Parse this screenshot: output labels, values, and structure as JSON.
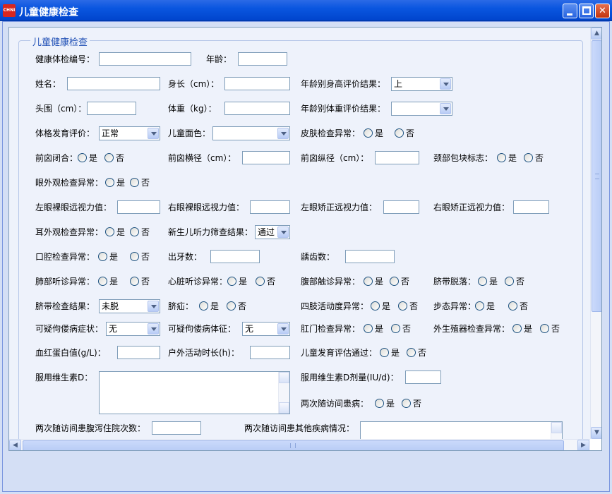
{
  "window": {
    "title": "儿童健康检查",
    "icon_text": "CHNI",
    "min_glyph": "",
    "max_glyph": "",
    "close_glyph": "✕"
  },
  "group": {
    "title": "儿童健康检查"
  },
  "radio_yes": "是",
  "radio_no": "否",
  "fields": {
    "exam_no": "健康体检编号：",
    "age": "年龄：",
    "name": "姓名：",
    "height": "身长（cm）：",
    "height_eval": "年龄别身高评价结果：",
    "height_eval_value": "上",
    "head": "头围（cm）：",
    "weight": "体重（kg）：",
    "weight_eval": "年龄别体重评价结果：",
    "weight_eval_value": "",
    "physique": "体格发育评价：",
    "physique_value": "正常",
    "complexion": "儿童面色：",
    "complexion_value": "",
    "skin": "皮肤检查异常：",
    "fontanel_closed": "前囟闭合：",
    "fontanel_h": "前囟横径（cm）：",
    "fontanel_v": "前囟纵径（cm）：",
    "neck_mass": "颈部包块标志：",
    "eye": "眼外观检查异常：",
    "left_naked": "左眼裸眼远视力值：",
    "right_naked": "右眼裸眼远视力值：",
    "left_corrected": "左眼矫正远视力值：",
    "right_corrected": "右眼矫正远视力值：",
    "ear": "耳外观检查异常：",
    "hearing": "新生儿听力筛查结果：",
    "hearing_value": "通过",
    "oral": "口腔检查异常：",
    "teeth": "出牙数：",
    "caries": "龋齿数：",
    "lung": "肺部听诊异常：",
    "heart": "心脏听诊异常：",
    "abdomen": "腹部触诊异常：",
    "umbilical_off": "脐带脱落：",
    "umbilical_check": "脐带检查结果：",
    "umbilical_check_value": "未脱",
    "hernia": "脐疝：",
    "limbs": "四肢活动度异常：",
    "gait": "步态异常：",
    "rickets_sym": "可疑佝偻病症状：",
    "rickets_sym_value": "无",
    "rickets_sign": "可疑佝偻病体征：",
    "rickets_sign_value": "无",
    "anus": "肛门检查异常：",
    "genital": "外生殖器检查异常：",
    "hemoglobin": "血红蛋白值(g/L)：",
    "outdoor": "户外活动时长(h)：",
    "growth_pass": "儿童发育评估通过：",
    "vitd": "服用维生素D：",
    "vitd_dose": "服用维生素D剂量(IU/d)：",
    "visit_ill": "两次随访间患病：",
    "diarrhea": "两次随访间患腹泻住院次数：",
    "other_disease": "两次随访间患其他疾病情况："
  }
}
